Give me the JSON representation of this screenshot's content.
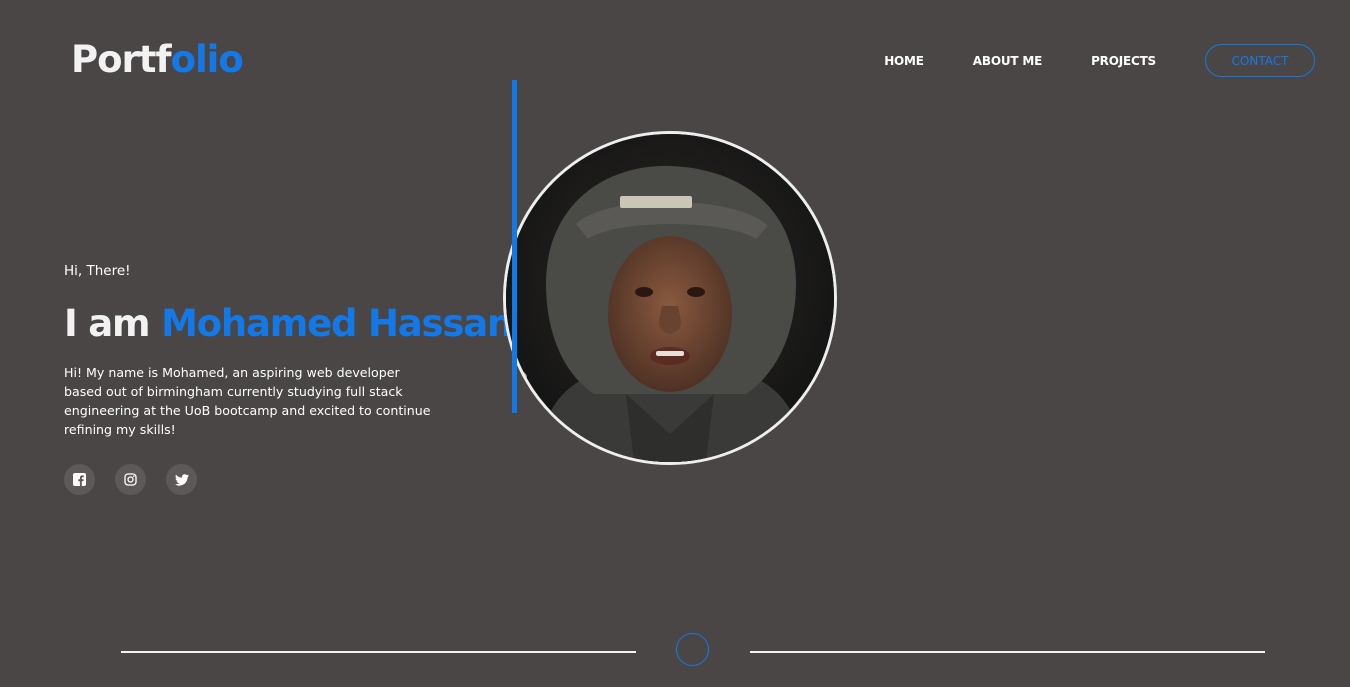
{
  "header": {
    "logo_part1": "Portf",
    "logo_part2": "olio",
    "nav": [
      {
        "label": "HOME"
      },
      {
        "label": "ABOUT ME"
      },
      {
        "label": "PROJECTS"
      }
    ],
    "contact_label": "CONTACT"
  },
  "hero": {
    "greeting": "Hi, There!",
    "headline_prefix": "I am",
    "headline_name": "Mohamed Hassan",
    "bio": "Hi! My name is Mohamed, an aspiring web developer based out of birmingham currently studying full stack engineering at the UoB bootcamp and excited to continue refining my skills!",
    "socials": [
      {
        "icon": "facebook-icon"
      },
      {
        "icon": "instagram-icon"
      },
      {
        "icon": "twitter-icon"
      }
    ]
  },
  "colors": {
    "background": "#4a4646",
    "accent": "#1479e8",
    "text": "#ffffff"
  }
}
